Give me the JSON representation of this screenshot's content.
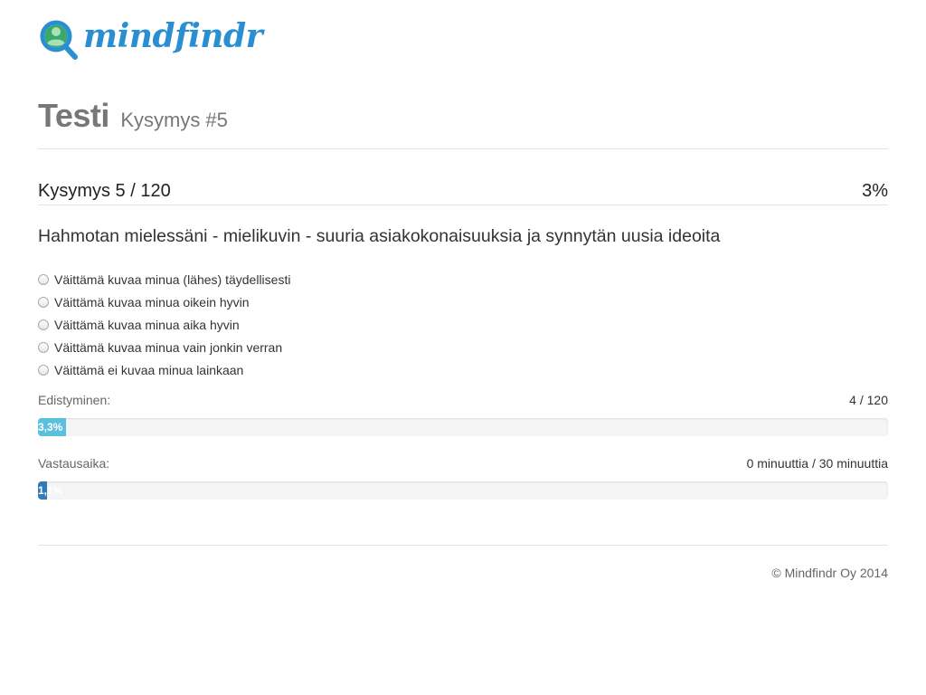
{
  "brand": {
    "name": "mindfindr",
    "color": "#2a8fd0"
  },
  "header": {
    "title": "Testi",
    "subtitle": "Kysymys #5"
  },
  "question": {
    "counter": "Kysymys 5 / 120",
    "percent": "3%",
    "text": "Hahmotan mielessäni - mielikuvin - suuria asiakokonaisuuksia ja synnytän uusia ideoita",
    "options": [
      "Väittämä kuvaa minua (lähes) täydellisesti",
      "Väittämä kuvaa minua oikein hyvin",
      "Väittämä kuvaa minua aika hyvin",
      "Väittämä kuvaa minua vain jonkin verran",
      "Väittämä ei kuvaa minua lainkaan"
    ]
  },
  "progress": {
    "label": "Edistyminen:",
    "value": "4 / 120",
    "bar_text": "3,3%",
    "fraction": 0.033,
    "color": "#5bc0de"
  },
  "time": {
    "label": "Vastausaika:",
    "value": "0 minuuttia / 30 minuuttia",
    "bar_text": "1,1%",
    "fraction": 0.011,
    "color": "#337ab7"
  },
  "footer": {
    "copyright": "© Mindfindr Oy 2014"
  }
}
